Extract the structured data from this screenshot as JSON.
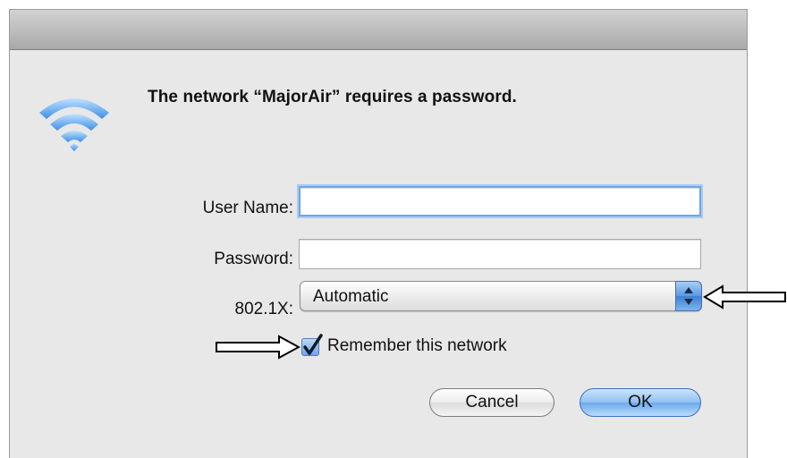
{
  "dialog": {
    "message": "The network “MajorAir” requires a password.",
    "icon": "wifi-icon"
  },
  "form": {
    "username_label": "User Name:",
    "username_value": "",
    "password_label": "Password:",
    "password_value": "",
    "auth_label": "802.1X:",
    "auth_selected": "Automatic",
    "remember_label": "Remember this network",
    "remember_checked": true
  },
  "buttons": {
    "cancel_label": "Cancel",
    "ok_label": "OK"
  },
  "colors": {
    "dialog_bg": "#e8e8e8",
    "focus_ring": "#6fa6e6",
    "accent_blue": "#5b98e3"
  }
}
